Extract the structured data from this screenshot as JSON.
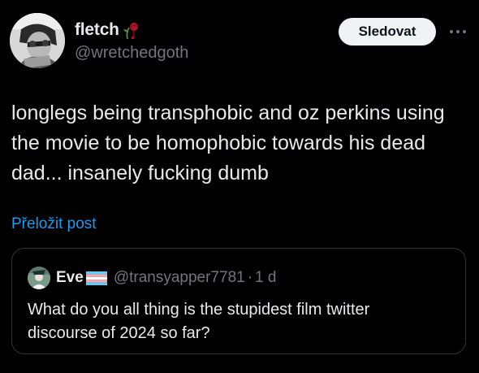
{
  "post": {
    "author_name": "fletch",
    "author_handle": "@wretchedgoth",
    "name_emoji": "wilted-rose-icon",
    "follow_label": "Sledovat",
    "more_icon": "more-horizontal-icon",
    "text": "longlegs being transphobic and oz perkins using\nthe movie to be homophobic towards his dead\ndad... insanely fucking dumb",
    "translate_label": "Přeložit post"
  },
  "quote": {
    "author_name": "Eve",
    "flag_icon": "transgender-flag-icon",
    "author_handle": "@transyapper7781",
    "separator": "·",
    "time": "1 d",
    "text": "What do you all thing is the stupidest film twitter\ndiscourse of 2024 so far?"
  },
  "colors": {
    "background": "#000000",
    "text_primary": "#e7e9ea",
    "text_secondary": "#71767b",
    "link": "#1d9bf0",
    "border": "#2f3336",
    "button_bg": "#eff3f4",
    "button_text": "#0f1419"
  }
}
